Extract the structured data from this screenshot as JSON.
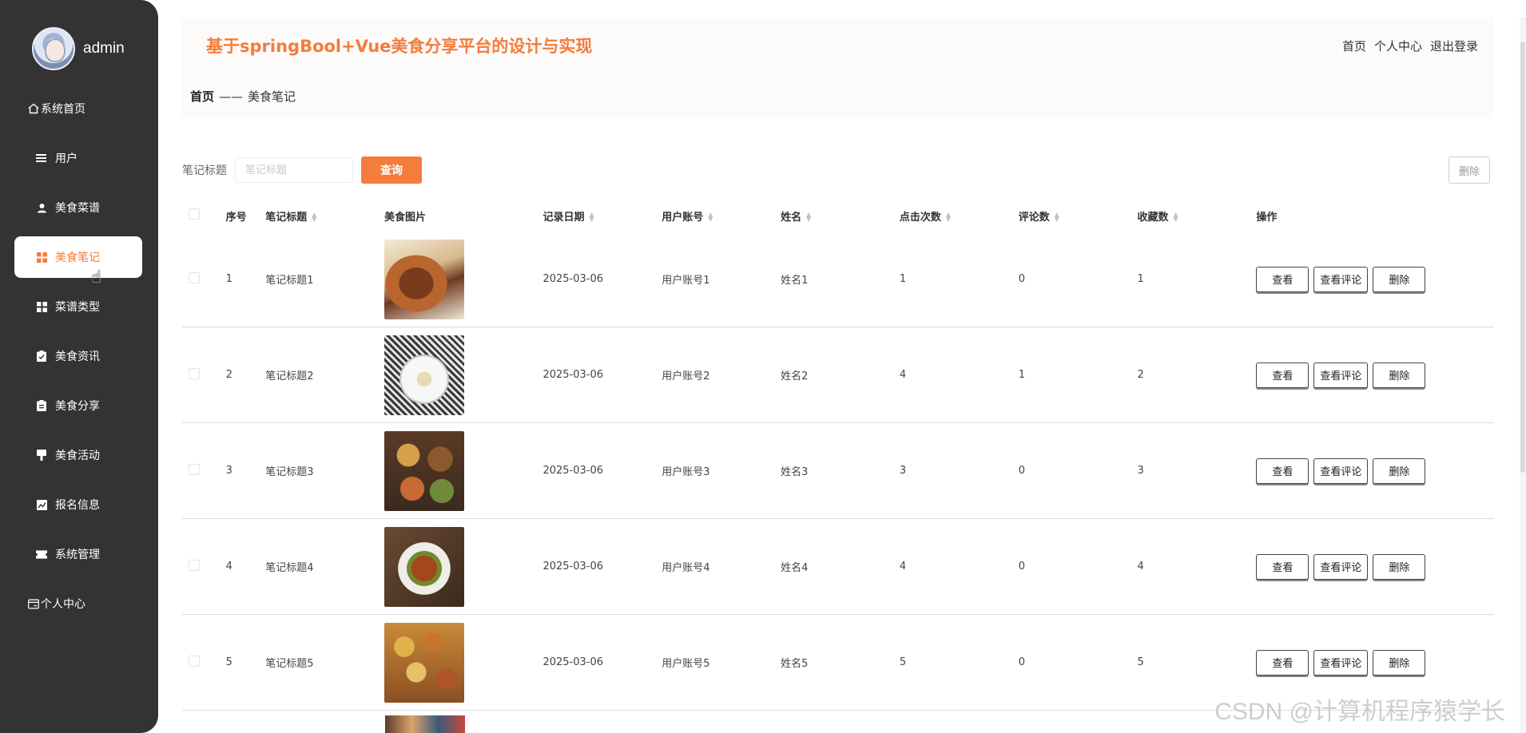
{
  "profile": {
    "name": "admin"
  },
  "sidebar": {
    "items": [
      {
        "label": "系统首页",
        "icon": "home-icon",
        "active": false
      },
      {
        "label": "用户",
        "icon": "list-icon",
        "active": false
      },
      {
        "label": "美食菜谱",
        "icon": "user-icon",
        "active": false
      },
      {
        "label": "美食笔记",
        "icon": "grid-icon",
        "active": true
      },
      {
        "label": "菜谱类型",
        "icon": "grid-icon",
        "active": false
      },
      {
        "label": "美食资讯",
        "icon": "clipboard-check-icon",
        "active": false
      },
      {
        "label": "美食分享",
        "icon": "clipboard-icon",
        "active": false
      },
      {
        "label": "美食活动",
        "icon": "flag-icon",
        "active": false
      },
      {
        "label": "报名信息",
        "icon": "chart-icon",
        "active": false
      },
      {
        "label": "系统管理",
        "icon": "ticket-icon",
        "active": false
      },
      {
        "label": "个人中心",
        "icon": "card-icon",
        "active": false
      }
    ]
  },
  "header": {
    "title": "基于springBool+Vue美食分享平台的设计与实现",
    "links": [
      "首页",
      "个人中心",
      "退出登录"
    ]
  },
  "breadcrumb": {
    "home": "首页",
    "separator": "——",
    "current": "美食笔记"
  },
  "search": {
    "label": "笔记标题",
    "placeholder": "笔记标题",
    "query_label": "查询",
    "delete_label": "删除"
  },
  "table": {
    "headers": {
      "index": "序号",
      "title": "笔记标题",
      "image": "美食图片",
      "date": "记录日期",
      "account": "用户账号",
      "name": "姓名",
      "clicks": "点击次数",
      "comments": "评论数",
      "favorites": "收藏数",
      "ops": "操作"
    },
    "actions": {
      "view": "查看",
      "comments": "查看评论",
      "delete": "删除"
    },
    "rows": [
      {
        "index": "1",
        "title": "笔记标题1",
        "date": "2025-03-06",
        "account": "用户账号1",
        "name": "姓名1",
        "clicks": "1",
        "comments": "0",
        "favorites": "1"
      },
      {
        "index": "2",
        "title": "笔记标题2",
        "date": "2025-03-06",
        "account": "用户账号2",
        "name": "姓名2",
        "clicks": "4",
        "comments": "1",
        "favorites": "2"
      },
      {
        "index": "3",
        "title": "笔记标题3",
        "date": "2025-03-06",
        "account": "用户账号3",
        "name": "姓名3",
        "clicks": "3",
        "comments": "0",
        "favorites": "3"
      },
      {
        "index": "4",
        "title": "笔记标题4",
        "date": "2025-03-06",
        "account": "用户账号4",
        "name": "姓名4",
        "clicks": "4",
        "comments": "0",
        "favorites": "4"
      },
      {
        "index": "5",
        "title": "笔记标题5",
        "date": "2025-03-06",
        "account": "用户账号5",
        "name": "姓名5",
        "clicks": "5",
        "comments": "0",
        "favorites": "5"
      }
    ]
  },
  "colors": {
    "accent": "#f47c3c",
    "sidebar": "#333333"
  },
  "watermark": "CSDN @计算机程序猿学长"
}
